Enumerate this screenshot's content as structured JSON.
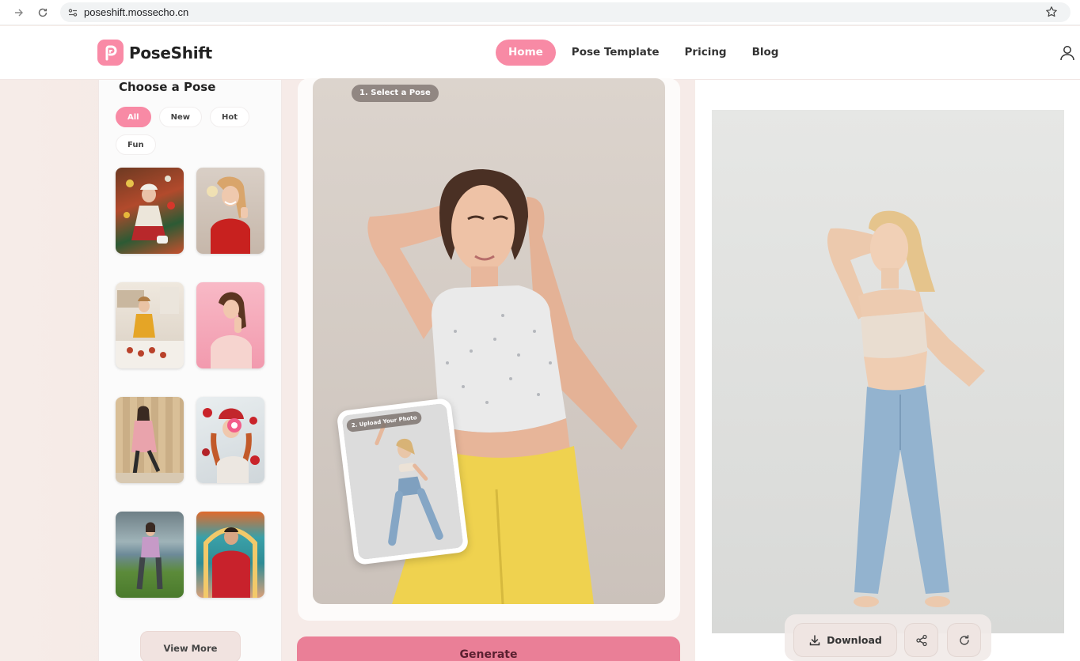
{
  "browser": {
    "url": "poseshift.mossecho.cn"
  },
  "header": {
    "logo_text": "PoseShift",
    "nav": [
      {
        "label": "Home",
        "active": true
      },
      {
        "label": "Pose Template",
        "active": false
      },
      {
        "label": "Pricing",
        "active": false
      },
      {
        "label": "Blog",
        "active": false
      }
    ]
  },
  "sidebar": {
    "title": "Choose a Pose",
    "filters": [
      {
        "label": "All",
        "active": true
      },
      {
        "label": "New",
        "active": false
      },
      {
        "label": "Hot",
        "active": false
      },
      {
        "label": "Fun",
        "active": false
      }
    ],
    "view_more_label": "View More"
  },
  "editor": {
    "select_badge": "1. Select a Pose",
    "upload_badge": "2. Upload Your Photo",
    "generate_label": "Generate"
  },
  "result": {
    "download_label": "Download"
  },
  "colors": {
    "accent_pink": "#f88aa5",
    "generate_pink": "#ea7f97"
  }
}
